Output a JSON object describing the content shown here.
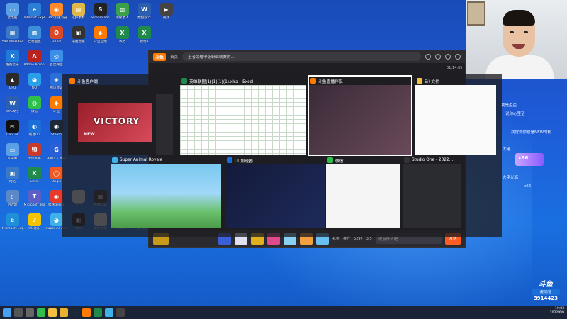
{
  "desktop_icons": [
    {
      "label": "此电脑",
      "color": "#5aa0e6",
      "glyph": "▭"
    },
    {
      "label": "Internet Explorer",
      "color": "#2b7fd6",
      "glyph": "e"
    },
    {
      "label": "2345加速浏览器",
      "color": "#ff8a2a",
      "glyph": "◉"
    },
    {
      "label": "选择素材",
      "color": "#e0b84a",
      "glyph": "▤"
    },
    {
      "label": "Streamlabs",
      "color": "#222222",
      "glyph": "S"
    },
    {
      "label": "南极老人",
      "color": "#3aa04a",
      "glyph": "▥"
    },
    {
      "label": "数据统计",
      "color": "#2b5fb0",
      "glyph": "W"
    },
    {
      "label": "视频",
      "color": "#444444",
      "glyph": "▶"
    },
    {
      "label": "Administrator",
      "color": "#3a78c8",
      "glyph": "▦"
    },
    {
      "label": "控制面板",
      "color": "#3b8fd8",
      "glyph": "▩"
    },
    {
      "label": "Office",
      "color": "#d84b2a",
      "glyph": "O"
    },
    {
      "label": "电脑管家",
      "color": "#333333",
      "glyph": "▣"
    },
    {
      "label": "斗鱼直播",
      "color": "#ff7a00",
      "glyph": "◆"
    },
    {
      "label": "表格",
      "color": "#1f8a4a",
      "glyph": "X"
    },
    {
      "label": "表格1",
      "color": "#1f8a4a",
      "glyph": "X"
    },
    {
      "label": "",
      "color": "#000000",
      "glyph": ""
    },
    {
      "label": "酷狗音乐",
      "color": "#1f7ad8",
      "glyph": "K"
    },
    {
      "label": "Adobe Acrobat DC",
      "color": "#b8231f",
      "glyph": "A"
    },
    {
      "label": "百度网盘",
      "color": "#3b8fe8",
      "glyph": "◎"
    },
    {
      "label": "",
      "color": "#000000",
      "glyph": ""
    },
    {
      "label": "",
      "color": "#000000",
      "glyph": ""
    },
    {
      "label": "",
      "color": "#000000",
      "glyph": ""
    },
    {
      "label": "",
      "color": "#000000",
      "glyph": ""
    },
    {
      "label": "",
      "color": "#000000",
      "glyph": ""
    },
    {
      "label": "GPU",
      "color": "#2a2a2a",
      "glyph": "▲"
    },
    {
      "label": "QQ",
      "color": "#2aa0e8",
      "glyph": "◕"
    },
    {
      "label": "腾讯会议",
      "color": "#2a6fd8",
      "glyph": "◈"
    },
    {
      "label": "",
      "color": "#000000",
      "glyph": ""
    },
    {
      "label": "",
      "color": "#000000",
      "glyph": ""
    },
    {
      "label": "",
      "color": "#000000",
      "glyph": ""
    },
    {
      "label": "",
      "color": "#000000",
      "glyph": ""
    },
    {
      "label": "",
      "color": "#000000",
      "glyph": ""
    },
    {
      "label": "WPS文字",
      "color": "#2b5fb0",
      "glyph": "W"
    },
    {
      "label": "微信",
      "color": "#2ec04a",
      "glyph": "◍"
    },
    {
      "label": "斗鱼",
      "color": "#ff7a00",
      "glyph": "◆"
    },
    {
      "label": "",
      "color": "#000000",
      "glyph": ""
    },
    {
      "label": "",
      "color": "#000000",
      "glyph": ""
    },
    {
      "label": "",
      "color": "#000000",
      "glyph": ""
    },
    {
      "label": "",
      "color": "#000000",
      "glyph": ""
    },
    {
      "label": "",
      "color": "#000000",
      "glyph": ""
    },
    {
      "label": "CapCut",
      "color": "#111111",
      "glyph": "✂"
    },
    {
      "label": "网易UU",
      "color": "#1a6fd8",
      "glyph": "◐"
    },
    {
      "label": "Steam",
      "color": "#1b2838",
      "glyph": "◉"
    },
    {
      "label": "",
      "color": "#000000",
      "glyph": ""
    },
    {
      "label": "",
      "color": "#000000",
      "glyph": ""
    },
    {
      "label": "",
      "color": "#000000",
      "glyph": ""
    },
    {
      "label": "",
      "color": "#000000",
      "glyph": ""
    },
    {
      "label": "",
      "color": "#000000",
      "glyph": ""
    },
    {
      "label": "此电脑",
      "color": "#5aa0e6",
      "glyph": "▭"
    },
    {
      "label": "中国象棋",
      "color": "#c83a2a",
      "glyph": "帅"
    },
    {
      "label": "Garry's Mod",
      "color": "#2a5fd8",
      "glyph": "G"
    },
    {
      "label": "",
      "color": "#000000",
      "glyph": ""
    },
    {
      "label": "",
      "color": "#000000",
      "glyph": ""
    },
    {
      "label": "",
      "color": "#000000",
      "glyph": ""
    },
    {
      "label": "",
      "color": "#000000",
      "glyph": ""
    },
    {
      "label": "",
      "color": "#000000",
      "glyph": ""
    },
    {
      "label": "网络",
      "color": "#3a78c8",
      "glyph": "▣"
    },
    {
      "label": "Excel",
      "color": "#1f8a4a",
      "glyph": "X"
    },
    {
      "label": "Origin",
      "color": "#f05a22",
      "glyph": "◯"
    },
    {
      "label": "",
      "color": "#000000",
      "glyph": ""
    },
    {
      "label": "",
      "color": "#000000",
      "glyph": ""
    },
    {
      "label": "",
      "color": "#000000",
      "glyph": ""
    },
    {
      "label": "",
      "color": "#000000",
      "glyph": ""
    },
    {
      "label": "",
      "color": "#000000",
      "glyph": ""
    },
    {
      "label": "回收站",
      "color": "#5a88c8",
      "glyph": "▯"
    },
    {
      "label": "Microsoft Teams",
      "color": "#5b5fc7",
      "glyph": "T"
    },
    {
      "label": "极速浏览器",
      "color": "#e83a2a",
      "glyph": "◉"
    },
    {
      "label": "文档",
      "color": "#f0f0f0",
      "glyph": "▯"
    },
    {
      "label": "视频剪辑",
      "color": "#333333",
      "glyph": "▦"
    },
    {
      "label": "表格2",
      "color": "#1f8a4a",
      "glyph": "X"
    },
    {
      "label": "",
      "color": "#000000",
      "glyph": ""
    },
    {
      "label": "",
      "color": "#000000",
      "glyph": ""
    },
    {
      "label": "Microsoft Edge",
      "color": "#1e8fd8",
      "glyph": "e"
    },
    {
      "label": "QQ音乐",
      "color": "#f5c400",
      "glyph": "♪"
    },
    {
      "label": "Super Animal",
      "color": "#3fb0e8",
      "glyph": "◕"
    },
    {
      "label": "PUBG",
      "color": "#222222",
      "glyph": "▣"
    },
    {
      "label": "新建文本",
      "color": "#f0f0f0",
      "glyph": "▯"
    },
    {
      "label": "Word",
      "color": "#2b5fb0",
      "glyph": "W"
    },
    {
      "label": "看看素材",
      "color": "#f0f0f0",
      "glyph": "▯"
    },
    {
      "label": "",
      "color": "#000000",
      "glyph": ""
    }
  ],
  "browser": {
    "logo": "斗鱼",
    "back_tab": "首页",
    "url_title": "王者荣耀甲级职业联赛的...",
    "time_hint": "01:14:05"
  },
  "bottom_bar": {
    "rank_label": "排行",
    "gift_label": "礼物",
    "stat1": "5297",
    "stat2": "3.5",
    "chat_placeholder": "说点什么吧...",
    "send_label": "发送"
  },
  "chat_lines": [
    "我是歪歪",
    "说句心里话",
    "我觉得你也是NEW的粉",
    "大佬",
    "大佬光临",
    "x66"
  ],
  "badge": "x66",
  "switcher_tiles": [
    {
      "title": "斗鱼客户端",
      "icon_color": "#ff7a00"
    },
    {
      "title": "英雄联盟(1)(1)(1)(1).xlsx - Excel",
      "icon_color": "#1f8a4a"
    },
    {
      "title": "斗鱼直播伴侣",
      "icon_color": "#ff7a00"
    },
    {
      "title": "E:\\ 文件",
      "icon_color": "#f0c040"
    },
    {
      "title": "Super Animal Royale",
      "icon_color": "#3fb0e8"
    },
    {
      "title": "UU加速器",
      "icon_color": "#1a6fd8"
    },
    {
      "title": "微信",
      "icon_color": "#2ec04a"
    },
    {
      "title": "Studio One - 2022...",
      "icon_color": "#333333"
    }
  ],
  "victory_text": "VICTORY",
  "new_text": "NEW",
  "tray": {
    "time": "19:03",
    "date": "2022/6/9"
  },
  "douyu_mark": {
    "brand": "斗鱼",
    "sub": "房间号",
    "room": "3914423"
  }
}
